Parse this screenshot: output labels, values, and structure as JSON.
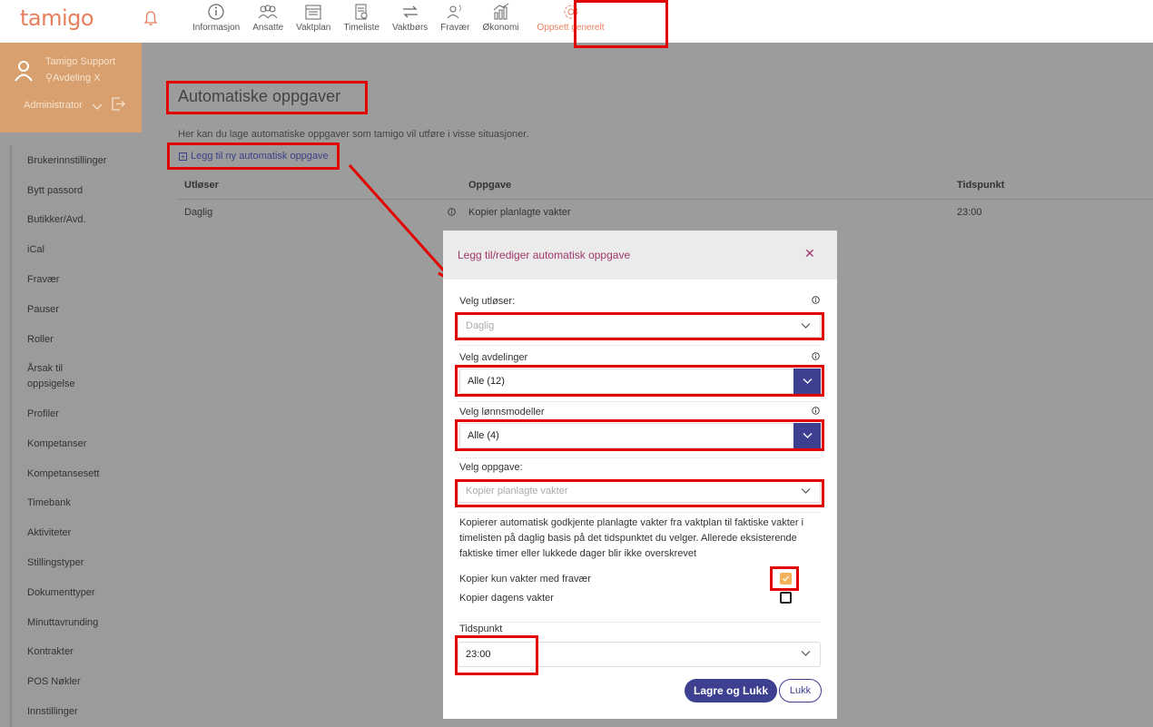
{
  "app": {
    "logo": "tamigo"
  },
  "nav": {
    "items": [
      {
        "label": "Informasjon",
        "icon": "info-icon"
      },
      {
        "label": "Ansatte",
        "icon": "users-icon"
      },
      {
        "label": "Vaktplan",
        "icon": "calendar-icon"
      },
      {
        "label": "Timeliste",
        "icon": "timesheet-icon"
      },
      {
        "label": "Vaktbørs",
        "icon": "swap-icon"
      },
      {
        "label": "Fravær",
        "icon": "absence-icon"
      },
      {
        "label": "Økonomi",
        "icon": "economy-icon"
      },
      {
        "label": "Oppsett generelt",
        "icon": "gear-icon",
        "active": true
      }
    ]
  },
  "profile": {
    "name": "Tamigo Support",
    "department": "Avdeling X",
    "role": "Administrator"
  },
  "sidebar": {
    "items": [
      "Brukerinnstillinger",
      "Bytt passord",
      "Butikker/Avd.",
      "iCal",
      "Fravær",
      "Pauser",
      "Roller",
      "Årsak til oppsigelse",
      "Profiler",
      "Kompetanser",
      "Kompetansesett",
      "Timebank",
      "Aktiviteter",
      "Stillingstyper",
      "Dokumenttyper",
      "Minuttavrunding",
      "Kontrakter",
      "POS Nøkler",
      "Innstillinger"
    ]
  },
  "page": {
    "title": "Automatiske oppgaver",
    "description": "Her kan du lage automatiske oppgaver som tamigo vil utføre i visse situasjoner.",
    "add_link": "Legg til ny automatisk oppgave",
    "table": {
      "headers": {
        "trigger": "Utløser",
        "task": "Oppgave",
        "time": "Tidspunkt"
      },
      "rows": [
        {
          "trigger": "Daglig",
          "task": "Kopier planlagte vakter",
          "time": "23:00"
        }
      ]
    }
  },
  "modal": {
    "title": "Legg til/rediger automatisk oppgave",
    "close_icon": "close-icon",
    "trigger_label": "Velg utløser:",
    "trigger_value": "Daglig",
    "departments_label": "Velg avdelinger",
    "departments_value": "Alle (12)",
    "payroll_label": "Velg lønnsmodeller",
    "payroll_value": "Alle (4)",
    "task_label": "Velg oppgave:",
    "task_value": "Kopier planlagte vakter",
    "task_description": "Kopierer automatisk godkjente planlagte vakter fra vaktplan til faktiske vakter i timelisten på daglig basis på det tidspunktet du velger. Allerede eksisterende faktiske timer eller lukkede dager blir ikke overskrevet",
    "check_absence_label": "Kopier kun vakter med fravær",
    "check_absence_checked": true,
    "check_today_label": "Kopier dagens vakter",
    "check_today_checked": false,
    "time_label": "Tidspunkt",
    "time_value": "23:00",
    "save_button": "Lagre og Lukk",
    "close_button": "Lukk"
  },
  "colors": {
    "brand": "#e8805e",
    "primary": "#3d3f91",
    "highlight": "#e30000",
    "modal_title": "#a0386b"
  }
}
